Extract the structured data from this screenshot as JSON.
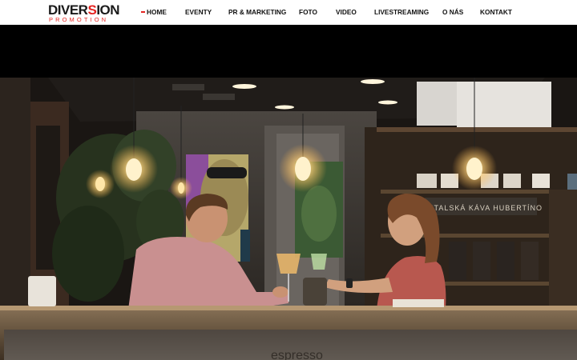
{
  "brand": {
    "name_part1": "DIVER",
    "name_accent": "S",
    "name_part2": "ION",
    "tagline": "PROMOTION"
  },
  "nav": {
    "items": [
      {
        "label": "HOME",
        "active": true
      },
      {
        "label": "EVENTY"
      },
      {
        "label": "PR & MARKETING"
      },
      {
        "label": "FOTO"
      },
      {
        "label": "VIDEO"
      },
      {
        "label": "LIVESTREAMING"
      },
      {
        "label": "O NÁS"
      },
      {
        "label": "KONTAKT"
      }
    ]
  },
  "hero": {
    "shelf_sign": "ITALSKÁ KÁVA HUBERTÍNO",
    "counter_text": "espresso"
  },
  "colors": {
    "accent": "#e52421",
    "header_bg": "#ffffff",
    "nav_text": "#111111"
  }
}
